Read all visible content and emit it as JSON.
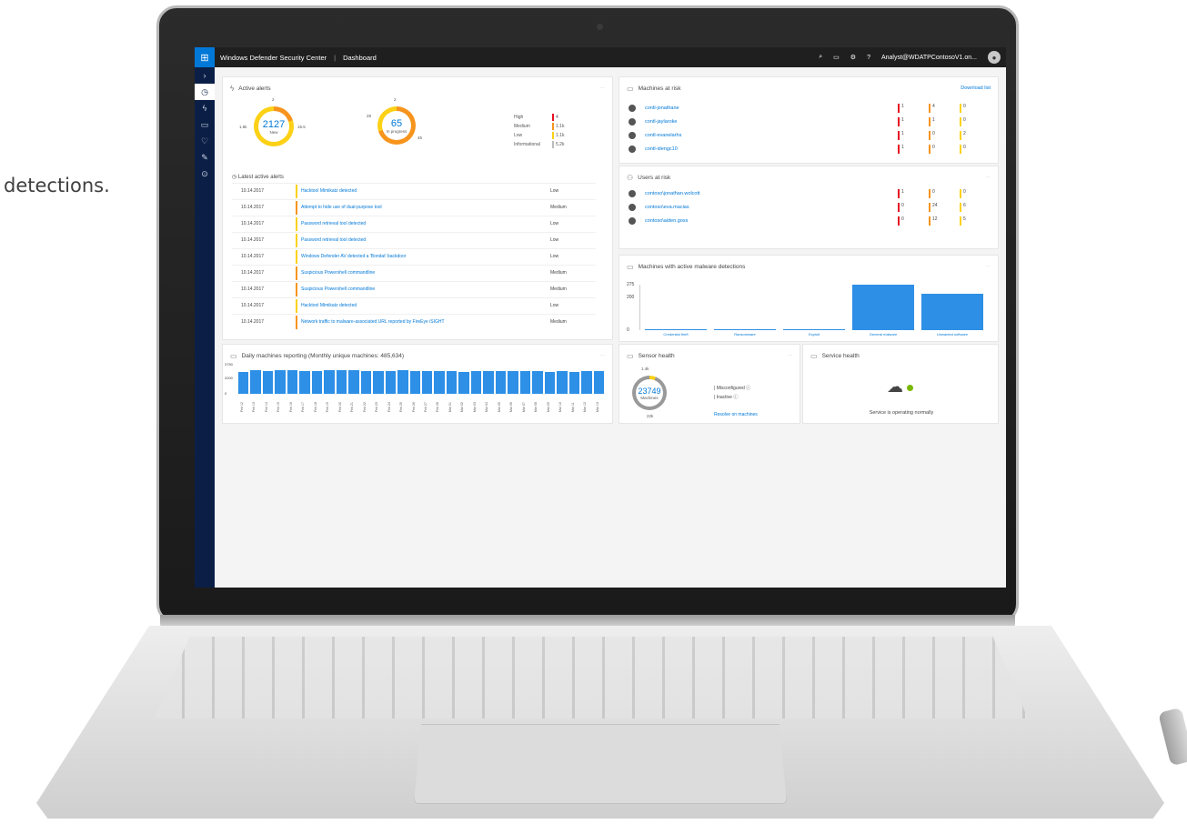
{
  "caption": "detections.",
  "topbar": {
    "logo": "windows-logo-icon",
    "app_title": "Windows Defender Security Center",
    "page": "Dashboard",
    "help": "?",
    "user": "Analyst@WDATPContosoV1.on..."
  },
  "active_alerts": {
    "title": "Active alerts",
    "status_donut": {
      "total": "2127",
      "label": "New",
      "left": "1.6k",
      "right": "16.5",
      "top": "2"
    },
    "progress_donut": {
      "total": "65",
      "label": "In progress",
      "left": "28",
      "top": "2",
      "right": "45"
    },
    "severity": [
      {
        "label": "High",
        "value": "4",
        "color": "#e81123"
      },
      {
        "label": "Medium",
        "value": "1.1k",
        "color": "#f7941d"
      },
      {
        "label": "Low",
        "value": "1.1k",
        "color": "#fcd116"
      },
      {
        "label": "Informational",
        "value": "5.2k",
        "color": "#bbbbbb"
      }
    ],
    "latest_title": "Latest active alerts",
    "rows": [
      {
        "date": "10.14.2017",
        "title": "Hacktool Mimikatz detected",
        "severity": "Low",
        "color": "#fcd116"
      },
      {
        "date": "10.14.2017",
        "title": "Attempt to hide use of dual-purpose tool",
        "severity": "Medium",
        "color": "#f7941d"
      },
      {
        "date": "10.14.2017",
        "title": "Password retrieval tool detected",
        "severity": "Low",
        "color": "#fcd116"
      },
      {
        "date": "10.14.2017",
        "title": "Password retrieval tool detected",
        "severity": "Low",
        "color": "#fcd116"
      },
      {
        "date": "10.14.2017",
        "title": "Windows Defender AV detected a 'Bondat' backdoor",
        "severity": "Low",
        "color": "#fcd116"
      },
      {
        "date": "10.14.2017",
        "title": "Suspicious Powershell commandline",
        "severity": "Medium",
        "color": "#f7941d"
      },
      {
        "date": "10.14.2017",
        "title": "Suspicious Powershell commandline",
        "severity": "Medium",
        "color": "#f7941d"
      },
      {
        "date": "10.14.2017",
        "title": "Hacktool Mimikatz detected",
        "severity": "Low",
        "color": "#fcd116"
      },
      {
        "date": "10.14.2017",
        "title": "Network traffic to malware-associated URL reported by FireEye iSIGHT",
        "severity": "Medium",
        "color": "#f7941d"
      }
    ]
  },
  "machines_at_risk": {
    "title": "Machines at risk",
    "link": "Download list",
    "rows": [
      {
        "name": "contl-jonathane",
        "h": "1",
        "m": "4",
        "l": "0"
      },
      {
        "name": "contl-jaylaroke",
        "h": "1",
        "m": "1",
        "l": "0"
      },
      {
        "name": "contl-evanelarhs",
        "h": "1",
        "m": "0",
        "l": "2"
      },
      {
        "name": "contl-idengc10",
        "h": "1",
        "m": "0",
        "l": "0"
      }
    ]
  },
  "users_at_risk": {
    "title": "Users at risk",
    "rows": [
      {
        "name": "contoso\\jonathan.wolcott",
        "h": "1",
        "m": "0",
        "l": "0"
      },
      {
        "name": "contoso\\eva.macias",
        "h": "0",
        "m": "24",
        "l": "6"
      },
      {
        "name": "contoso\\aiden.goss",
        "h": "0",
        "m": "12",
        "l": "5"
      }
    ]
  },
  "malware_chart": {
    "title": "Machines with active malware detections",
    "chart_data": {
      "type": "bar",
      "categories": [
        "Credential theft",
        "Ransomware",
        "Exploit",
        "General malware",
        "Unwanted software"
      ],
      "values": [
        2,
        2,
        3,
        275,
        218
      ],
      "ylim": [
        0,
        275
      ],
      "ticks": [
        "275",
        "200",
        "0"
      ],
      "grid": false,
      "color": "#2d8fe6"
    }
  },
  "daily_reporting": {
    "title": "Daily machines reporting (Monthly unique machines: 485,634)",
    "chart_data": {
      "type": "bar",
      "categories": [
        "Feb 12",
        "Feb 13",
        "Feb 14",
        "Feb 15",
        "Feb 16",
        "Feb 17",
        "Feb 18",
        "Feb 19",
        "Feb 20",
        "Feb 21",
        "Feb 22",
        "Feb 23",
        "Feb 24",
        "Feb 25",
        "Feb 26",
        "Feb 27",
        "Feb 28",
        "Mar 01",
        "Mar 02",
        "Mar 03",
        "Mar 04",
        "Mar 05",
        "Mar 06",
        "Mar 07",
        "Mar 08",
        "Mar 09",
        "Mar 10",
        "Mar 11",
        "Mar 12",
        "Mar 13"
      ],
      "values": [
        2850,
        2990,
        2900,
        3000,
        2990,
        2900,
        2960,
        3000,
        3000,
        3000,
        2960,
        2880,
        2900,
        3000,
        2950,
        2900,
        2900,
        2880,
        2850,
        2950,
        2950,
        2950,
        2900,
        2880,
        2900,
        2830,
        2880,
        2830,
        2880,
        2920
      ],
      "ylim": [
        0,
        3750
      ],
      "ticks": [
        "3750",
        "2000",
        "0"
      ],
      "color": "#2d8fe6"
    }
  },
  "sensor_health": {
    "title": "Sensor health",
    "total": "23749",
    "label": "Machines",
    "top": "1.4k",
    "bottom": "22k",
    "items": [
      "Misconfigured",
      "Inactive"
    ],
    "link": "Resolve on machines"
  },
  "service_health": {
    "title": "Service health",
    "status": "Service is operating normally"
  }
}
